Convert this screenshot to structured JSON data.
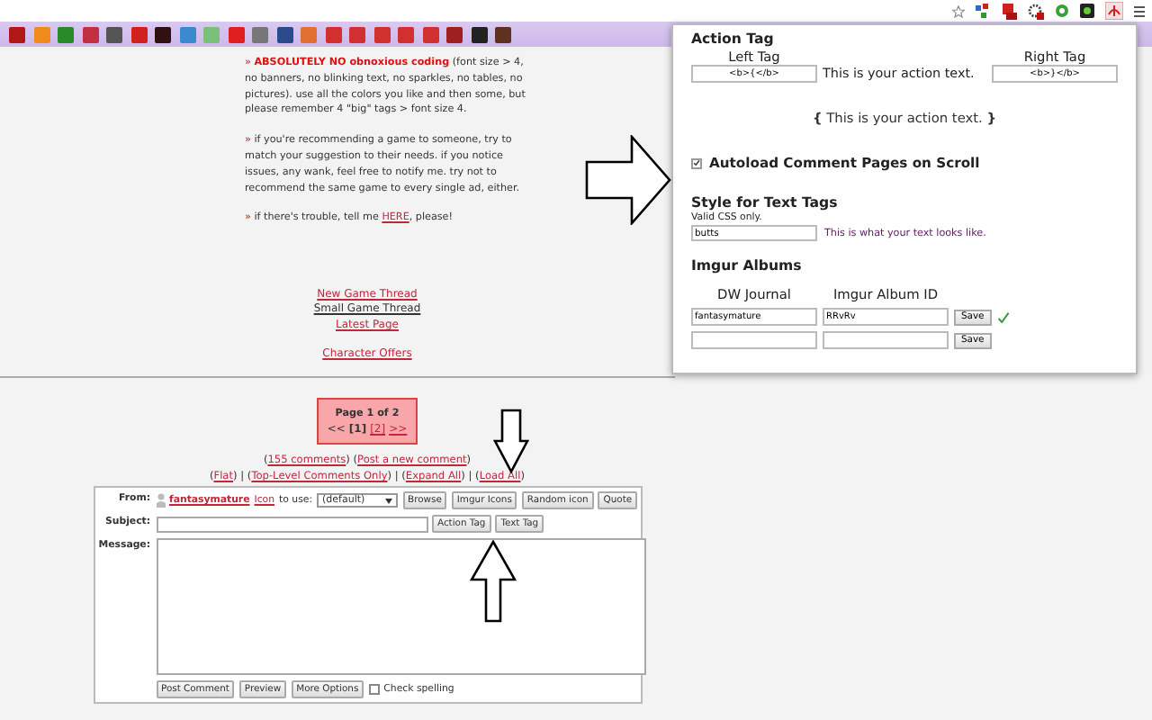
{
  "rules": [
    {
      "bullet": "»",
      "segments": [
        {
          "kind": "text",
          "text": "**ABSOLUTELY NO obnoxious coding** (font size > 4, no banners, no blinking text, no sparkles, no tables, no pictures). use all the colors you like and then some, but please remember 4 \"big\" tags > font size 4."
        }
      ]
    },
    {
      "bullet": "»",
      "segments": [
        {
          "kind": "text",
          "text": "if you're recommending a game to someone, try to match your suggestion to their needs. if you notice issues, any wank, feel free to notify me. try not to recommend the same game to every single ad, either."
        }
      ]
    },
    {
      "bullet": "»",
      "segments": [
        {
          "kind": "text",
          "text": "if there's trouble, tell me "
        },
        {
          "kind": "link",
          "text": "HERE"
        },
        {
          "kind": "text",
          "text": ", please!"
        }
      ]
    }
  ],
  "nav_links": [
    {
      "label": "New Game Thread",
      "visited": false
    },
    {
      "label": "Small Game Thread",
      "visited": true
    },
    {
      "label": "Latest Page",
      "visited": false
    },
    {
      "label": "Character Offers",
      "visited": false
    }
  ],
  "pager": {
    "title": "Page 1 of 2",
    "items": [
      {
        "text": "<<",
        "kind": "inactive"
      },
      {
        "text": "[1]",
        "kind": "current"
      },
      {
        "text": "[2]",
        "kind": "link"
      },
      {
        "text": ">>",
        "kind": "link"
      }
    ]
  },
  "comment_links": [
    [
      {
        "kind": "text",
        "text": "("
      },
      {
        "kind": "link",
        "text": "155 comments"
      },
      {
        "kind": "text",
        "text": ") ("
      },
      {
        "kind": "link",
        "text": "Post a new comment"
      },
      {
        "kind": "text",
        "text": ")"
      }
    ],
    [
      {
        "kind": "text",
        "text": "("
      },
      {
        "kind": "link",
        "text": "Flat"
      },
      {
        "kind": "text",
        "text": ") | ("
      },
      {
        "kind": "link",
        "text": "Top-Level Comments Only"
      },
      {
        "kind": "text",
        "text": ") | ("
      },
      {
        "kind": "link",
        "text": "Expand All"
      },
      {
        "kind": "text",
        "text": ") | ("
      },
      {
        "kind": "link",
        "text": "Load All"
      },
      {
        "kind": "text",
        "text": ")"
      }
    ]
  ],
  "form": {
    "from_label": "From:",
    "user": "fantasymature",
    "icon_link": "Icon",
    "icon_text": "to use:",
    "icon_select": "(default)",
    "icon_buttons": [
      "Browse",
      "Imgur Icons",
      "Random icon",
      "Quote"
    ],
    "subject_label": "Subject:",
    "subject_buttons": [
      "Action Tag",
      "Text Tag"
    ],
    "message_label": "Message:",
    "bottom_buttons": [
      "Post Comment",
      "Preview",
      "More Options"
    ],
    "check_spelling": {
      "label": "Check spelling",
      "checked": false
    }
  },
  "popup": {
    "action_tag": {
      "title": "Action Tag",
      "left_label": "Left Tag",
      "right_label": "Right Tag",
      "left_value": "<b>{</b>",
      "middle": "This is your action text.",
      "right_value": "<b>}</b>",
      "preview": "**{** This is your action text. **}**"
    },
    "autoload": {
      "label": "Autoload Comment Pages on Scroll",
      "checked": true
    },
    "style": {
      "title": "Style for Text Tags",
      "hint": "Valid CSS only.",
      "value": "butts",
      "preview": "This is what your text looks like."
    },
    "imgur": {
      "title": "Imgur Albums",
      "columns": [
        "DW Journal",
        "Imgur Album ID"
      ],
      "rows": [
        {
          "journal": "fantasymature",
          "album": "RRvRv",
          "button": "Save",
          "saved": true
        },
        {
          "button": "Save",
          "saved": false
        }
      ]
    }
  }
}
